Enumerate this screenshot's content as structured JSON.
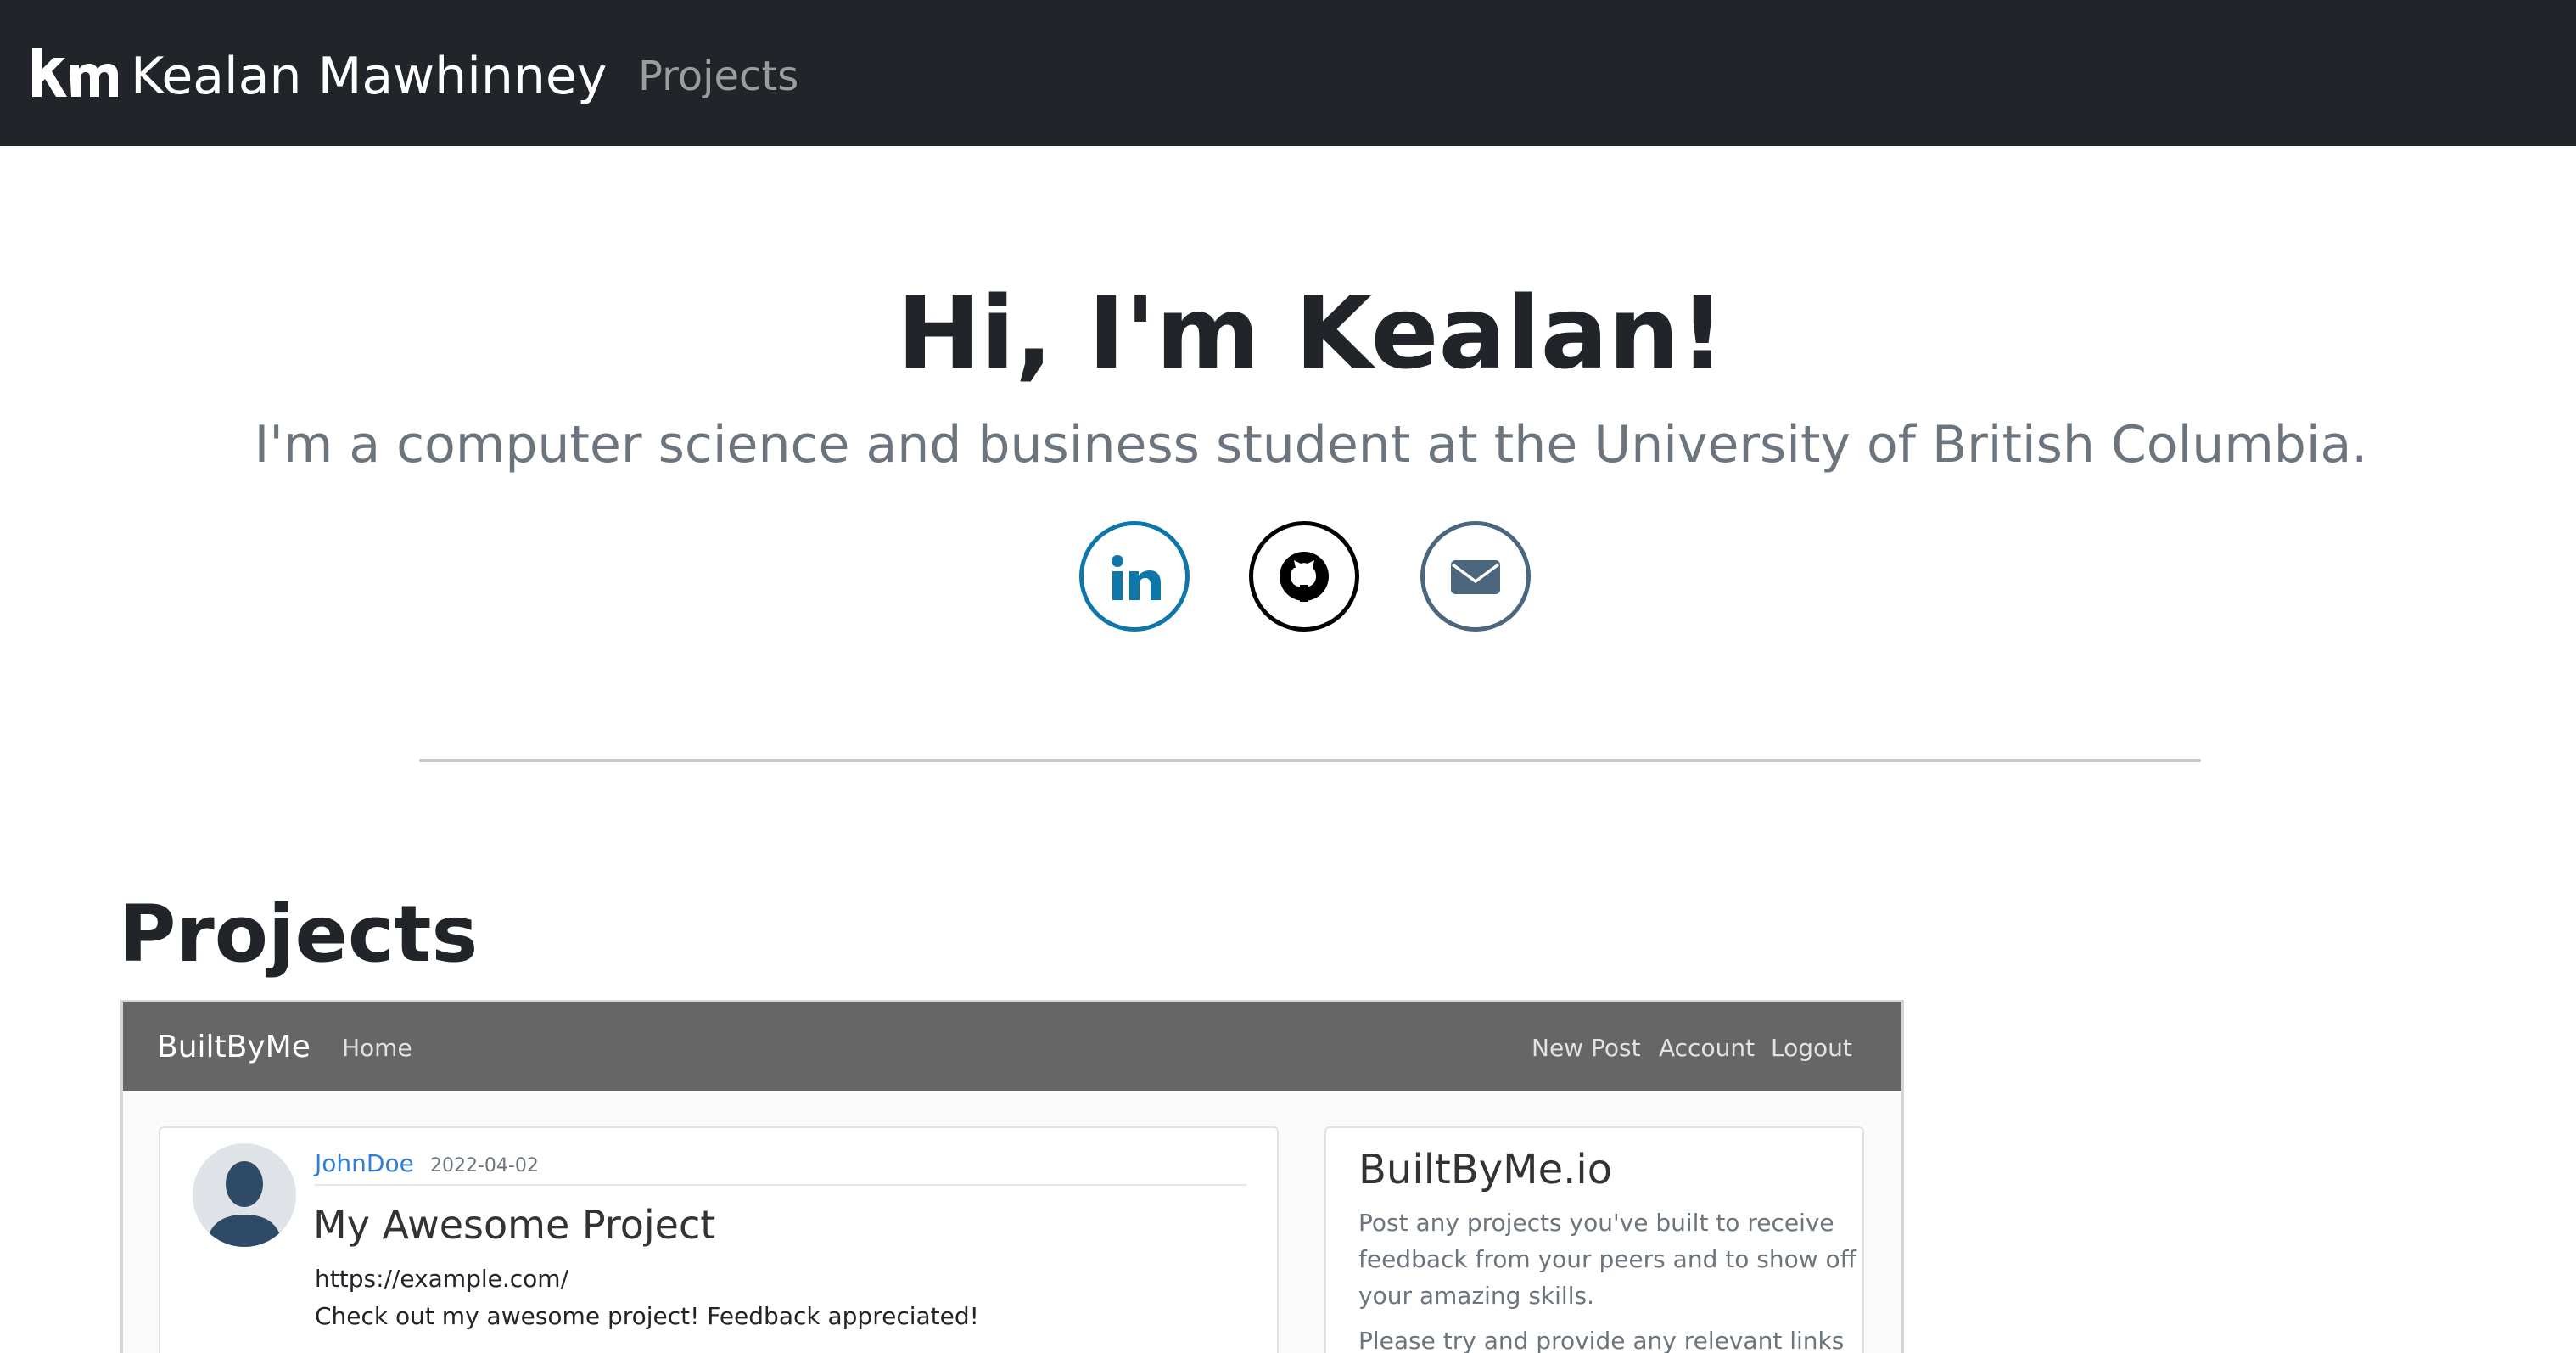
{
  "navbar": {
    "logo_text": "km",
    "brand": "Kealan Mawhinney",
    "nav_links": [
      "Projects"
    ]
  },
  "hero": {
    "title": "Hi, I'm Kealan!",
    "subtitle": "I'm a computer science and business student at the University of British Columbia.",
    "social": [
      {
        "icon": "linkedin-icon",
        "color": "#0e76a8"
      },
      {
        "icon": "github-icon",
        "color": "#000000"
      },
      {
        "icon": "envelope-icon",
        "color": "#4b667d"
      }
    ]
  },
  "projects": {
    "heading": "Projects",
    "screenshot": {
      "brand": "BuiltByMe",
      "nav_left": [
        "Home"
      ],
      "nav_right": [
        "New Post",
        "Account",
        "Logout"
      ],
      "post": {
        "author": "JohnDoe",
        "date": "2022-04-02",
        "title": "My Awesome Project",
        "url": "https://example.com/",
        "body": "Check out my awesome project! Feedback appreciated!"
      },
      "sidebar": {
        "title": "BuiltByMe.io",
        "lines": [
          "Post any projects you've built to receive",
          "feedback from your peers and to show off",
          "your amazing skills.",
          "Please try and provide any relevant links"
        ]
      }
    }
  },
  "colors": {
    "navbar_bg": "#212529",
    "linkedin": "#0e76a8",
    "link_blue": "#2f7fd8",
    "muted": "#6c757d"
  }
}
